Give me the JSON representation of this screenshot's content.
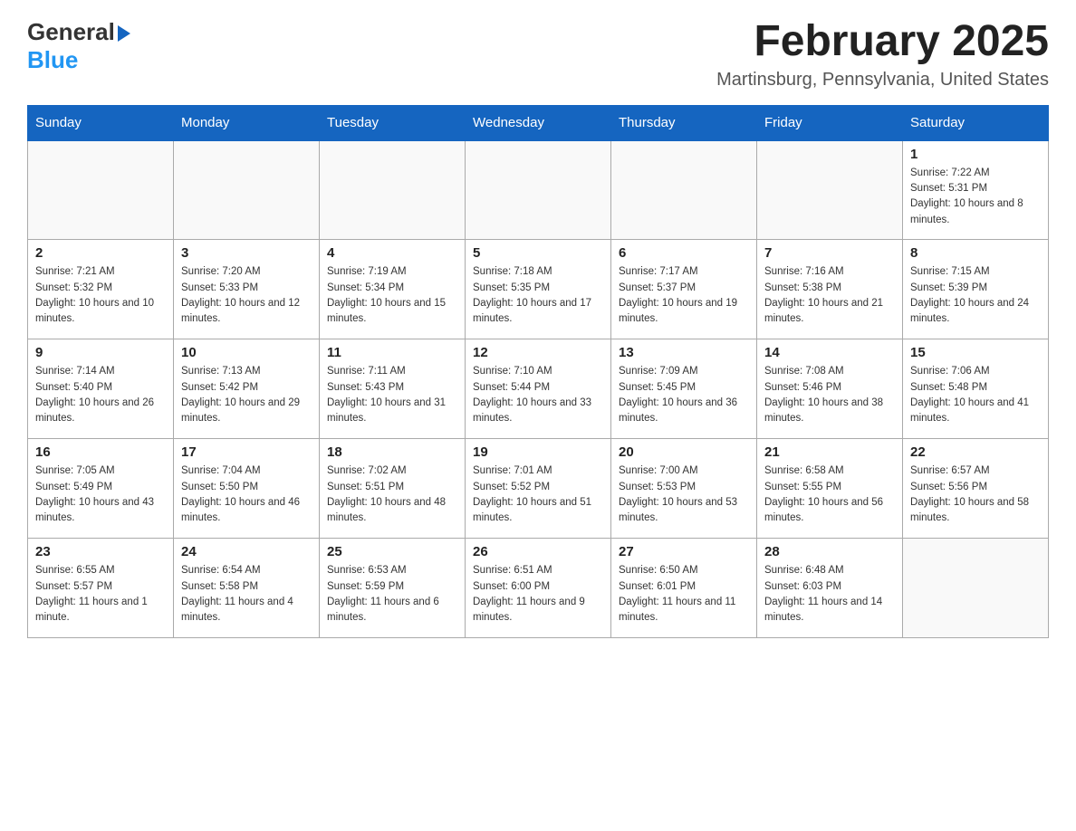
{
  "header": {
    "logo_general": "General",
    "logo_blue": "Blue",
    "calendar_title": "February 2025",
    "calendar_subtitle": "Martinsburg, Pennsylvania, United States"
  },
  "days_of_week": [
    "Sunday",
    "Monday",
    "Tuesday",
    "Wednesday",
    "Thursday",
    "Friday",
    "Saturday"
  ],
  "weeks": [
    {
      "days": [
        {
          "date": "",
          "info": ""
        },
        {
          "date": "",
          "info": ""
        },
        {
          "date": "",
          "info": ""
        },
        {
          "date": "",
          "info": ""
        },
        {
          "date": "",
          "info": ""
        },
        {
          "date": "",
          "info": ""
        },
        {
          "date": "1",
          "info": "Sunrise: 7:22 AM\nSunset: 5:31 PM\nDaylight: 10 hours and 8 minutes."
        }
      ]
    },
    {
      "days": [
        {
          "date": "2",
          "info": "Sunrise: 7:21 AM\nSunset: 5:32 PM\nDaylight: 10 hours and 10 minutes."
        },
        {
          "date": "3",
          "info": "Sunrise: 7:20 AM\nSunset: 5:33 PM\nDaylight: 10 hours and 12 minutes."
        },
        {
          "date": "4",
          "info": "Sunrise: 7:19 AM\nSunset: 5:34 PM\nDaylight: 10 hours and 15 minutes."
        },
        {
          "date": "5",
          "info": "Sunrise: 7:18 AM\nSunset: 5:35 PM\nDaylight: 10 hours and 17 minutes."
        },
        {
          "date": "6",
          "info": "Sunrise: 7:17 AM\nSunset: 5:37 PM\nDaylight: 10 hours and 19 minutes."
        },
        {
          "date": "7",
          "info": "Sunrise: 7:16 AM\nSunset: 5:38 PM\nDaylight: 10 hours and 21 minutes."
        },
        {
          "date": "8",
          "info": "Sunrise: 7:15 AM\nSunset: 5:39 PM\nDaylight: 10 hours and 24 minutes."
        }
      ]
    },
    {
      "days": [
        {
          "date": "9",
          "info": "Sunrise: 7:14 AM\nSunset: 5:40 PM\nDaylight: 10 hours and 26 minutes."
        },
        {
          "date": "10",
          "info": "Sunrise: 7:13 AM\nSunset: 5:42 PM\nDaylight: 10 hours and 29 minutes."
        },
        {
          "date": "11",
          "info": "Sunrise: 7:11 AM\nSunset: 5:43 PM\nDaylight: 10 hours and 31 minutes."
        },
        {
          "date": "12",
          "info": "Sunrise: 7:10 AM\nSunset: 5:44 PM\nDaylight: 10 hours and 33 minutes."
        },
        {
          "date": "13",
          "info": "Sunrise: 7:09 AM\nSunset: 5:45 PM\nDaylight: 10 hours and 36 minutes."
        },
        {
          "date": "14",
          "info": "Sunrise: 7:08 AM\nSunset: 5:46 PM\nDaylight: 10 hours and 38 minutes."
        },
        {
          "date": "15",
          "info": "Sunrise: 7:06 AM\nSunset: 5:48 PM\nDaylight: 10 hours and 41 minutes."
        }
      ]
    },
    {
      "days": [
        {
          "date": "16",
          "info": "Sunrise: 7:05 AM\nSunset: 5:49 PM\nDaylight: 10 hours and 43 minutes."
        },
        {
          "date": "17",
          "info": "Sunrise: 7:04 AM\nSunset: 5:50 PM\nDaylight: 10 hours and 46 minutes."
        },
        {
          "date": "18",
          "info": "Sunrise: 7:02 AM\nSunset: 5:51 PM\nDaylight: 10 hours and 48 minutes."
        },
        {
          "date": "19",
          "info": "Sunrise: 7:01 AM\nSunset: 5:52 PM\nDaylight: 10 hours and 51 minutes."
        },
        {
          "date": "20",
          "info": "Sunrise: 7:00 AM\nSunset: 5:53 PM\nDaylight: 10 hours and 53 minutes."
        },
        {
          "date": "21",
          "info": "Sunrise: 6:58 AM\nSunset: 5:55 PM\nDaylight: 10 hours and 56 minutes."
        },
        {
          "date": "22",
          "info": "Sunrise: 6:57 AM\nSunset: 5:56 PM\nDaylight: 10 hours and 58 minutes."
        }
      ]
    },
    {
      "days": [
        {
          "date": "23",
          "info": "Sunrise: 6:55 AM\nSunset: 5:57 PM\nDaylight: 11 hours and 1 minute."
        },
        {
          "date": "24",
          "info": "Sunrise: 6:54 AM\nSunset: 5:58 PM\nDaylight: 11 hours and 4 minutes."
        },
        {
          "date": "25",
          "info": "Sunrise: 6:53 AM\nSunset: 5:59 PM\nDaylight: 11 hours and 6 minutes."
        },
        {
          "date": "26",
          "info": "Sunrise: 6:51 AM\nSunset: 6:00 PM\nDaylight: 11 hours and 9 minutes."
        },
        {
          "date": "27",
          "info": "Sunrise: 6:50 AM\nSunset: 6:01 PM\nDaylight: 11 hours and 11 minutes."
        },
        {
          "date": "28",
          "info": "Sunrise: 6:48 AM\nSunset: 6:03 PM\nDaylight: 11 hours and 14 minutes."
        },
        {
          "date": "",
          "info": ""
        }
      ]
    }
  ]
}
